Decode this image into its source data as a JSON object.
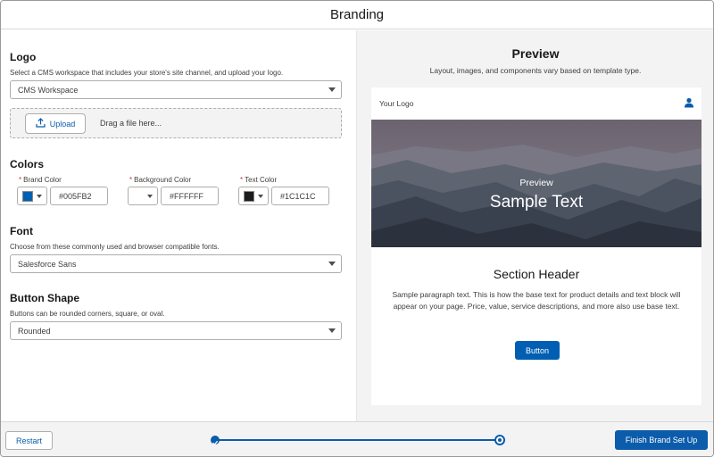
{
  "header": {
    "title": "Branding"
  },
  "logo_section": {
    "title": "Logo",
    "help": "Select a CMS workspace that includes your store's site channel, and upload your logo.",
    "workspace_select": "CMS Workspace",
    "upload_label": "Upload",
    "drag_text": "Drag a file here..."
  },
  "colors_section": {
    "title": "Colors",
    "required_marker": "*",
    "brand": {
      "label": "Brand Color",
      "value": "#005FB2",
      "swatch": "#005fb2"
    },
    "background": {
      "label": "Background Color",
      "value": "#FFFFFF",
      "swatch": "#ffffff"
    },
    "text": {
      "label": "Text Color",
      "value": "#1C1C1C",
      "swatch": "#1c1c1c"
    }
  },
  "font_section": {
    "title": "Font",
    "help": "Choose from these commonly used and browser compatible fonts.",
    "selected": "Salesforce Sans"
  },
  "button_shape_section": {
    "title": "Button Shape",
    "help": "Buttons can be rounded corners, square, or oval.",
    "selected": "Rounded"
  },
  "preview": {
    "title": "Preview",
    "subtitle": "Layout, images, and components vary based on template type.",
    "logo_text": "Your Logo",
    "hero_small": "Preview",
    "hero_big": "Sample Text",
    "section_header": "Section Header",
    "paragraph": "Sample paragraph text. This is how the base text for product details and text block will appear on your page. Price, value, service descriptions, and more also use base text.",
    "button_label": "Button"
  },
  "footer": {
    "restart_label": "Restart",
    "finish_label": "Finish Brand Set Up",
    "progress": {
      "total_steps": 2,
      "completed_steps": 1
    }
  },
  "icons": {
    "upload": "upload-icon",
    "user": "user-icon",
    "caret": "chevron-down-icon",
    "step_complete": "check-icon"
  },
  "colors": {
    "accent": "#0b5cab",
    "brand": "#005fb2",
    "preview_bg": "#f3f3f3"
  }
}
